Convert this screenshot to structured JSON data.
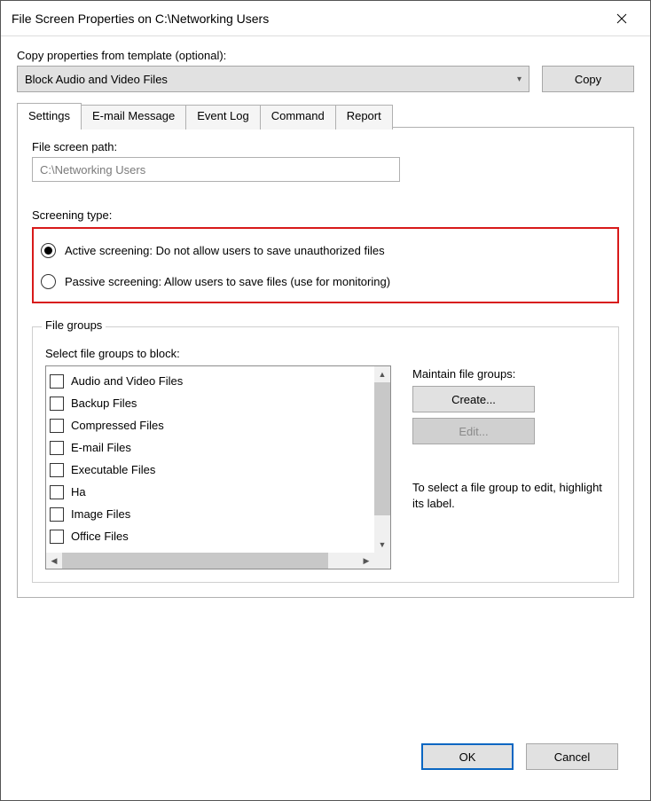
{
  "window": {
    "title": "File Screen Properties on C:\\Networking Users"
  },
  "template": {
    "label": "Copy properties from template (optional):",
    "selected": "Block Audio and Video Files",
    "copy_button": "Copy"
  },
  "tabs": [
    {
      "label": "Settings",
      "active": true
    },
    {
      "label": "E-mail Message",
      "active": false
    },
    {
      "label": "Event Log",
      "active": false
    },
    {
      "label": "Command",
      "active": false
    },
    {
      "label": "Report",
      "active": false
    }
  ],
  "settings": {
    "path_label": "File screen path:",
    "path_value": "C:\\Networking Users",
    "screening_label": "Screening type:",
    "screening_options": [
      {
        "label": "Active screening: Do not allow users to save unauthorized files",
        "selected": true
      },
      {
        "label": "Passive screening: Allow users to save files (use for monitoring)",
        "selected": false
      }
    ],
    "file_groups": {
      "box_title": "File groups",
      "select_label": "Select file groups to block:",
      "items": [
        {
          "label": "Audio and Video Files",
          "checked": false
        },
        {
          "label": "Backup Files",
          "checked": false
        },
        {
          "label": "Compressed Files",
          "checked": false
        },
        {
          "label": "E-mail Files",
          "checked": false
        },
        {
          "label": "Executable Files",
          "checked": false
        },
        {
          "label": "Ha",
          "checked": false
        },
        {
          "label": "Image Files",
          "checked": false
        },
        {
          "label": "Office Files",
          "checked": false
        }
      ],
      "maintain_label": "Maintain file groups:",
      "create_button": "Create...",
      "edit_button": "Edit...",
      "hint": "To select a file group to edit, highlight its label."
    }
  },
  "footer": {
    "ok": "OK",
    "cancel": "Cancel"
  }
}
